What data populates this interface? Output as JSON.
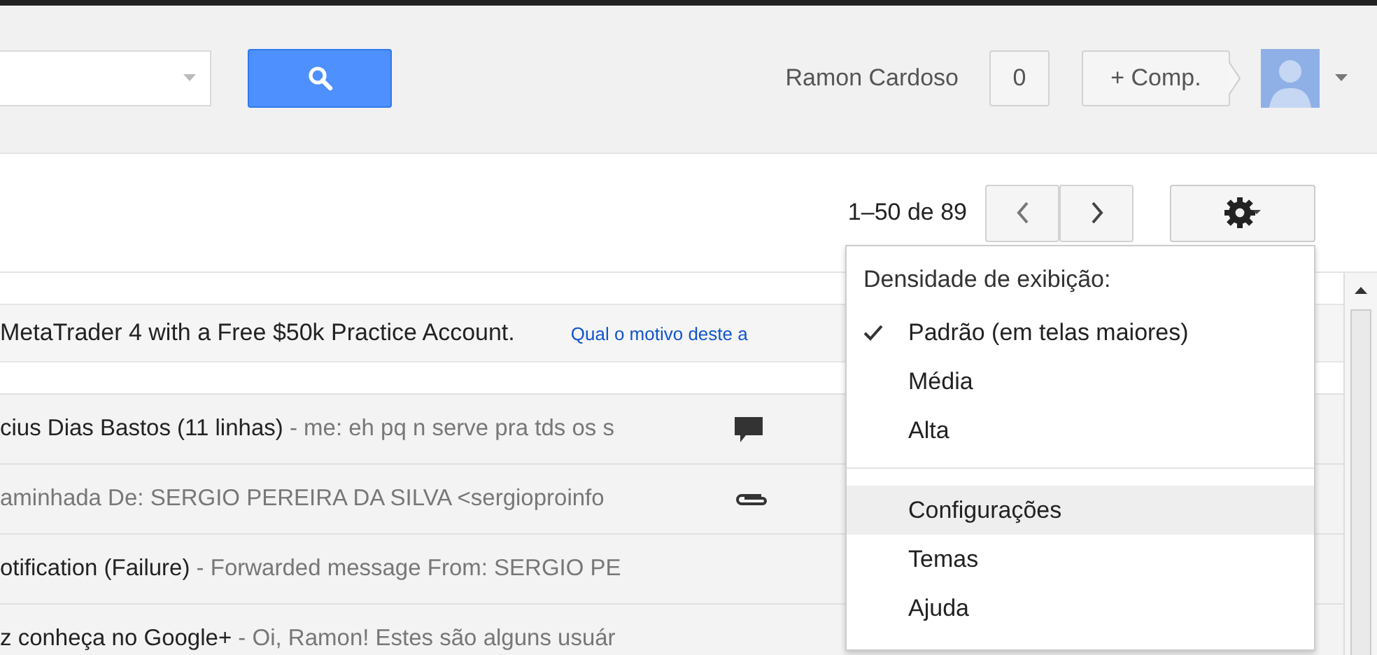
{
  "header": {
    "user_name": "Ramon Cardoso",
    "notifications": "0",
    "share_button": "+ Comp."
  },
  "toolbar": {
    "page_range": "1–50 de 89"
  },
  "ad": {
    "text": "MetaTrader 4 with a Free $50k Practice Account.",
    "link": "Qual o motivo deste a"
  },
  "messages": [
    {
      "subject": "cius Dias Bastos (11 linhas)",
      "snippet": " - me: eh pq n serve pra tds os s",
      "kind": "chat"
    },
    {
      "snippet": "aminhada De: SERGIO PEREIRA DA SILVA <sergioproinfo",
      "kind": "attachment"
    },
    {
      "subject": "otification (Failure)",
      "snippet": " - Forwarded message From: SERGIO PE",
      "kind": "plain"
    },
    {
      "subject": "z conheça no Google+",
      "snippet": " - Oi, Ramon! Estes são alguns usuár",
      "kind": "plain"
    }
  ],
  "settings_menu": {
    "heading": "Densidade de exibição:",
    "density_options": [
      {
        "label": "Padrão (em telas maiores)",
        "selected": true
      },
      {
        "label": "Média",
        "selected": false
      },
      {
        "label": "Alta",
        "selected": false
      }
    ],
    "items": [
      {
        "label": "Configurações",
        "selected": true
      },
      {
        "label": "Temas",
        "selected": false
      },
      {
        "label": "Ajuda",
        "selected": false
      }
    ]
  }
}
